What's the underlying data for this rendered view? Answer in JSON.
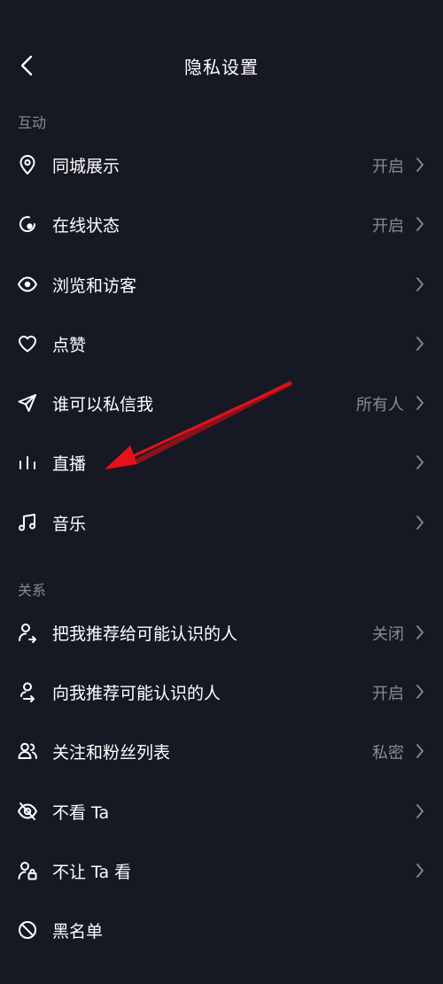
{
  "header": {
    "title": "隐私设置",
    "back_icon": "chevron-left-icon"
  },
  "sections": [
    {
      "label": "互动",
      "items": [
        {
          "label": "同城展示",
          "value": "开启",
          "icon": "location-pin-icon"
        },
        {
          "label": "在线状态",
          "value": "开启",
          "icon": "online-status-icon"
        },
        {
          "label": "浏览和访客",
          "value": "",
          "icon": "eye-icon"
        },
        {
          "label": "点赞",
          "value": "",
          "icon": "heart-icon"
        },
        {
          "label": "谁可以私信我",
          "value": "所有人",
          "icon": "send-icon"
        },
        {
          "label": "直播",
          "value": "",
          "icon": "live-bars-icon"
        },
        {
          "label": "音乐",
          "value": "",
          "icon": "music-note-icon"
        }
      ]
    },
    {
      "label": "关系",
      "items": [
        {
          "label": "把我推荐给可能认识的人",
          "value": "关闭",
          "icon": "user-share-icon"
        },
        {
          "label": "向我推荐可能认识的人",
          "value": "开启",
          "icon": "user-recommend-icon"
        },
        {
          "label": "关注和粉丝列表",
          "value": "私密",
          "icon": "users-icon"
        },
        {
          "label": "不看 Ta",
          "value": "",
          "icon": "eye-off-icon"
        },
        {
          "label": "不让 Ta 看",
          "value": "",
          "icon": "user-lock-icon"
        },
        {
          "label": "黑名单",
          "value": "",
          "icon": "block-icon"
        }
      ]
    }
  ],
  "colors": {
    "background": "#161823",
    "text": "#ffffff",
    "secondary": "#8a8b91",
    "annotation": "#e8101a"
  }
}
